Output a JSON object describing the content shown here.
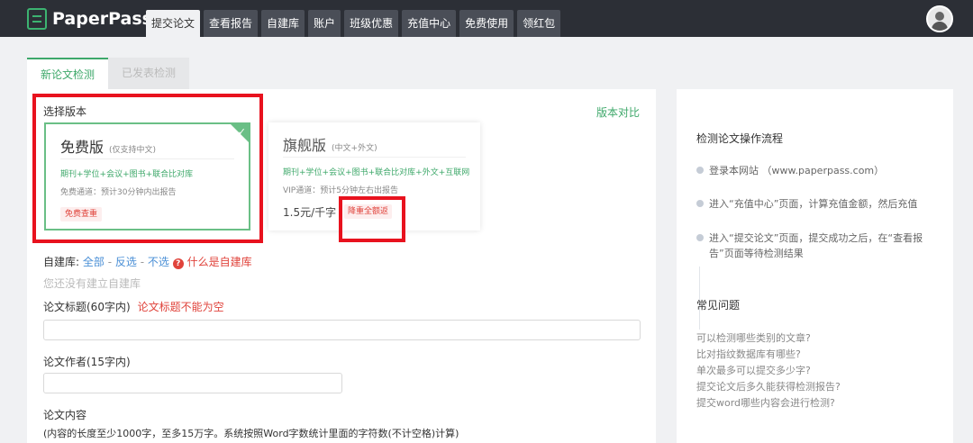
{
  "header": {
    "logo_text": "PaperPass",
    "nav": [
      "提交论文",
      "查看报告",
      "自建库",
      "账户",
      "班级优惠",
      "充值中心",
      "免费使用",
      "领红包"
    ],
    "active_nav": "提交论文",
    "avatar_icon": "user-avatar-icon"
  },
  "subtabs": {
    "new": "新论文检测",
    "published": "已发表检测"
  },
  "version": {
    "label": "选择版本",
    "compare_link": "版本对比",
    "free": {
      "title": "免费版",
      "subtitle": "(仅支持中文)",
      "databases": "期刊+学位+会议+图书+联合比对库",
      "note": "免费通道：预计30分钟内出报告",
      "badge": "免费查重"
    },
    "flagship": {
      "title": "旗舰版",
      "subtitle": "(中文+外文)",
      "databases": "期刊+学位+会议+图书+联合比对库+外文+互联网",
      "note": "VIP通道：预计5分钟左右出报告",
      "price": "1.5元/千字",
      "badge": "降重全额返"
    }
  },
  "library": {
    "label": "自建库:",
    "all": "全部",
    "invert": "反选",
    "none": "不选",
    "sep": "-",
    "help": "什么是自建库",
    "empty": "您还没有建立自建库"
  },
  "form": {
    "title_label": "论文标题(60字内)",
    "title_error": "论文标题不能为空",
    "title_value": "",
    "author_label": "论文作者(15字内)",
    "author_value": "",
    "content_label": "论文内容",
    "content_hint": "(内容的长度至少1000字，至多15万字。系统按照Word字数统计里面的字符数(不计空格)计算)"
  },
  "sidebar": {
    "process_title": "检测论文操作流程",
    "steps": [
      "登录本网站 （www.paperpass.com）",
      "进入“充值中心”页面，计算充值金额，然后充值",
      "进入“提交论文”页面，提交成功之后，在“查看报告”页面等待检测结果"
    ],
    "faq_title": "常见问题",
    "faqs": [
      "可以检测哪些类别的文章?",
      "比对指纹数据库有哪些?",
      "单次最多可以提交多少字?",
      "提交论文后多久能获得检测报告?",
      "提交word哪些内容会进行检测?"
    ]
  },
  "colors": {
    "accent_green": "#3ea86a",
    "warning_red": "#e0433b",
    "highlight_red": "#e8121e",
    "topbar": "#2c2f36"
  }
}
